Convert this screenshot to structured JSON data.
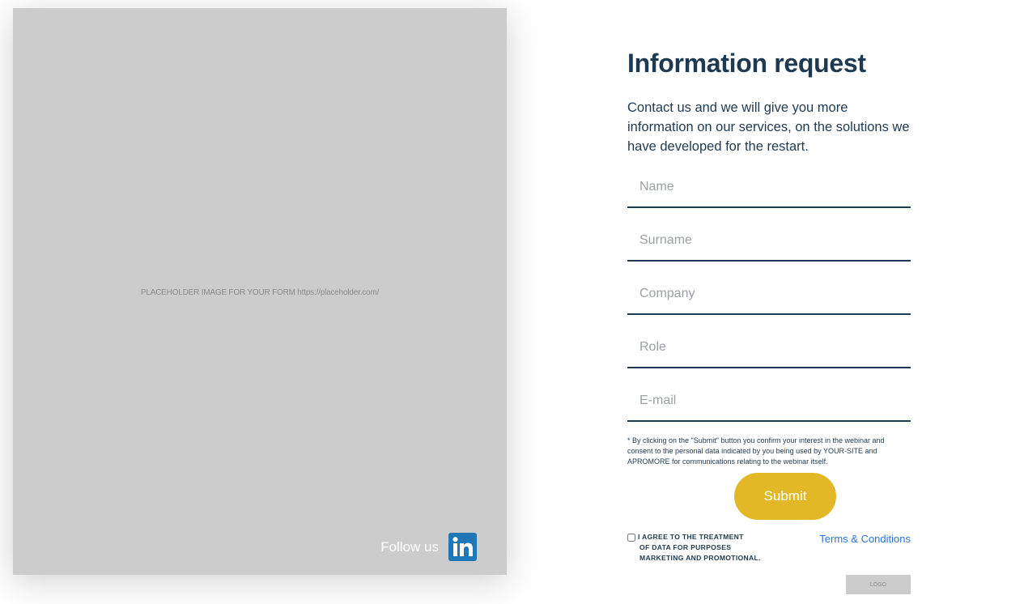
{
  "image_panel": {
    "placeholder_text": "PLACEHOLDER IMAGE FOR YOUR FORM https://placeholder.com/",
    "follow_label": "Follow us",
    "social_icon": "linkedin-icon",
    "background_color": "#cccccc"
  },
  "form": {
    "title": "Information request",
    "intro": "Contact us and we will give you more information on our services, on the solutions we have developed for the restart.",
    "fields": {
      "name": {
        "placeholder": "Name",
        "value": ""
      },
      "surname": {
        "placeholder": "Surname",
        "value": ""
      },
      "company": {
        "placeholder": "Company",
        "value": ""
      },
      "role": {
        "placeholder": "Role",
        "value": ""
      },
      "email": {
        "placeholder": "E-mail",
        "value": ""
      }
    },
    "consent_note": "* By clicking on the \"Submit\" button you confirm your interest in the webinar and consent to the personal data indicated by you being used by YOUR-SITE and APROMORE for communications relating to the webinar itself.",
    "submit_label": "Submit",
    "agree": {
      "line1": "I AGREE TO THE TREATMENT",
      "line2": "OF DATA FOR PURPOSES",
      "line3": "MARKETING AND PROMOTIONAL.",
      "checked": false
    },
    "terms_label": "Terms & Conditions",
    "logo_label": "LOGO"
  },
  "colors": {
    "text_primary": "#1e3a52",
    "accent_button": "#e2b827",
    "link": "#2a72d6",
    "linkedin": "#1d78b5",
    "placeholder_bg": "#cccccc"
  }
}
